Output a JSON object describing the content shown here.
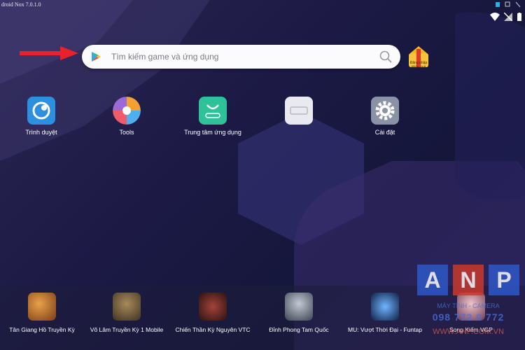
{
  "window": {
    "title": "droid Nox 7.0.1.0"
  },
  "search": {
    "placeholder": "Tìm kiếm game và ứng dụng"
  },
  "login_badge": {
    "label": "Đăng nhập nhận quà"
  },
  "apps": [
    {
      "label": "Trình duyệt",
      "icon": "browser-icon",
      "color": "#2d8fe0"
    },
    {
      "label": "Tools",
      "icon": "tools-icon",
      "color": "#f2a233"
    },
    {
      "label": "Trung tâm ứng dụng",
      "icon": "app-center-icon",
      "color": "#2fc29a"
    },
    {
      "label": "",
      "icon": "nox-icon",
      "color": "#e9eaf0"
    },
    {
      "label": "Cài đặt",
      "icon": "gear-icon",
      "color": "#8a93a6"
    }
  ],
  "games": [
    {
      "label": "Tân Giang Hồ Truyền Kỳ",
      "icon": "game-icon",
      "color": "#c8772a"
    },
    {
      "label": "Võ Lâm Truyền Kỳ 1 Mobile",
      "icon": "game-icon",
      "color": "#6d5a3a"
    },
    {
      "label": "Chiến Thần Kỳ Nguyên VTC",
      "icon": "game-icon",
      "color": "#5a2a2a"
    },
    {
      "label": "Đỉnh Phong Tam Quốc",
      "icon": "game-icon",
      "color": "#6d7b8a"
    },
    {
      "label": "MU: Vượt Thời Đại - Funtap",
      "icon": "game-icon",
      "color": "#1f3a66"
    },
    {
      "label": "Song Kiếm VGP",
      "icon": "game-icon",
      "color": "#b8758a"
    }
  ],
  "watermark": {
    "letters": [
      "A",
      "N",
      "P"
    ],
    "tagline": "MÁY TÍNH - CAMERA",
    "phone": "098 772 0 772",
    "site": "WWW.ANP.COM.VN",
    "colors": [
      "#2e58c8",
      "#c93a2d",
      "#2e58c8"
    ]
  }
}
